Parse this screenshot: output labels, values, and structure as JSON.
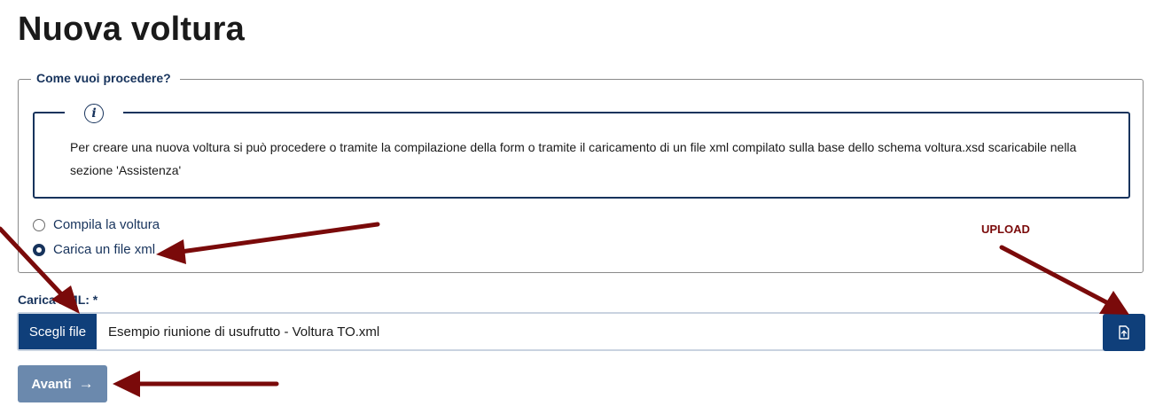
{
  "page": {
    "title": "Nuova voltura"
  },
  "fieldset": {
    "legend": "Come vuoi procedere?",
    "info": {
      "icon": "info-icon",
      "text": "Per creare una nuova voltura si può procedere o tramite la compilazione della form o tramite il caricamento di un file xml compilato sulla base dello schema voltura.xsd scaricabile nella sezione 'Assistenza'"
    },
    "options": [
      {
        "label": "Compila la voltura",
        "selected": false
      },
      {
        "label": "Carica un file xml",
        "selected": true
      }
    ]
  },
  "annotation": {
    "upload_label": "UPLOAD",
    "arrow_color": "#7a0a0a"
  },
  "upload": {
    "label": "Carica XML: *",
    "choose_button": "Scegli file",
    "file_name": "Esempio riunione di usufrutto - Voltura TO.xml",
    "upload_icon": "file-upload-icon"
  },
  "actions": {
    "next_label": "Avanti",
    "next_icon": "arrow-right-icon"
  },
  "colors": {
    "primary": "#0f3f7a",
    "heading_blue": "#17335c",
    "disabled_button": "#6b89ad"
  }
}
